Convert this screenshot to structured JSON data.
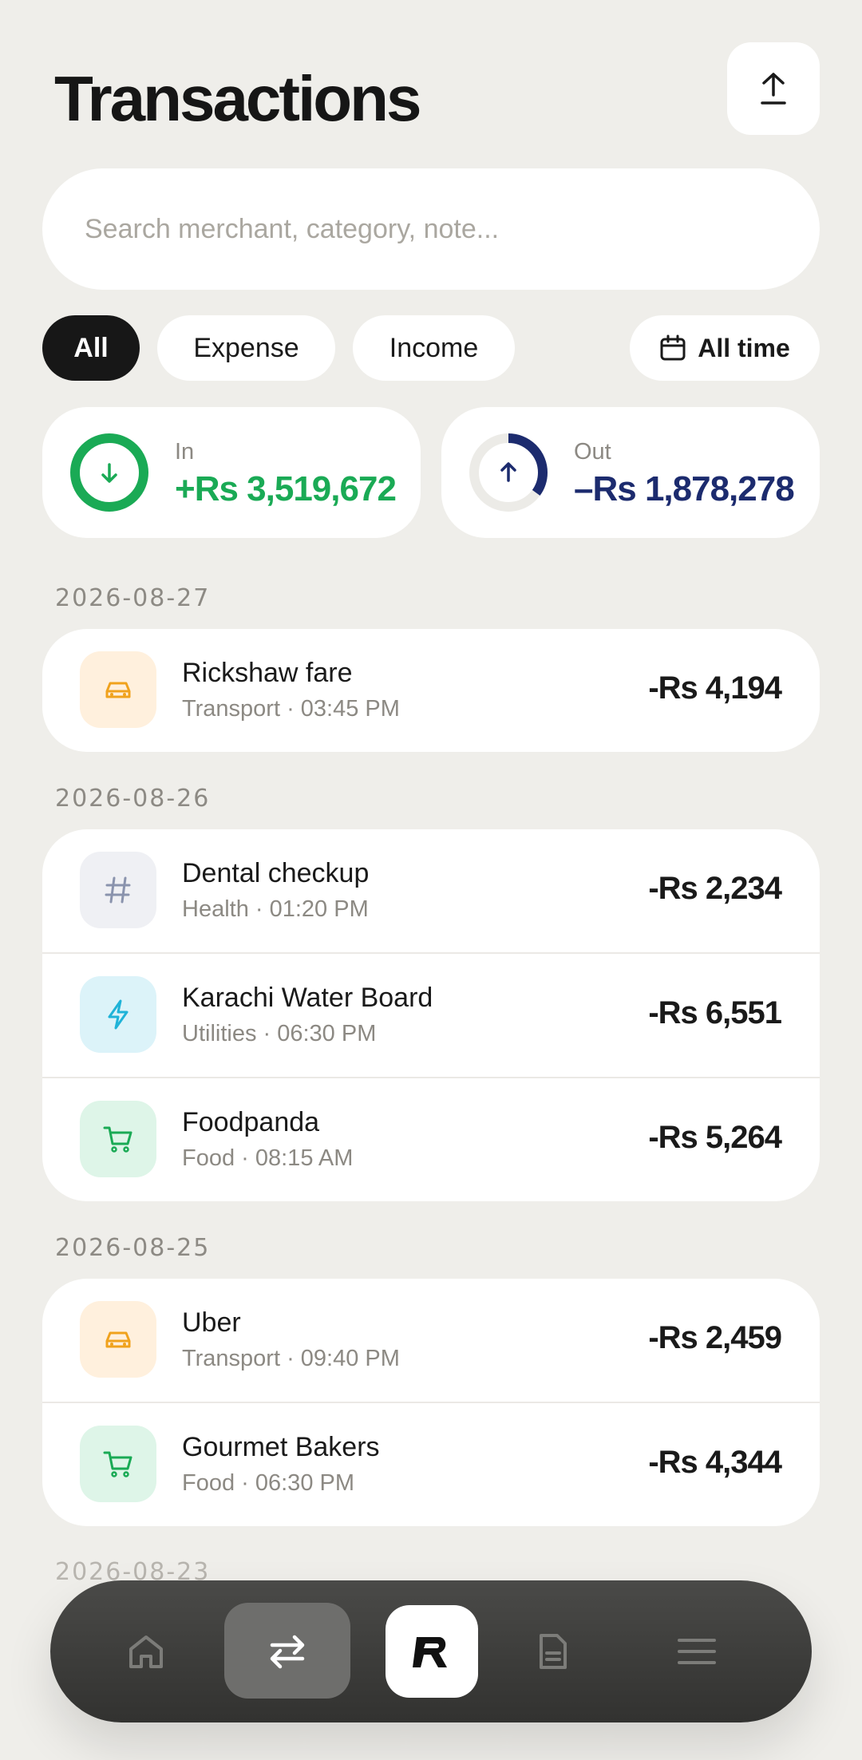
{
  "header": {
    "title": "Transactions",
    "export_icon": "upload-icon"
  },
  "search": {
    "placeholder": "Search merchant, category, note..."
  },
  "filters": {
    "chips": [
      {
        "label": "All",
        "active": true
      },
      {
        "label": "Expense",
        "active": false
      },
      {
        "label": "Income",
        "active": false
      }
    ],
    "date_range": {
      "label": "All time",
      "icon": "calendar-icon"
    }
  },
  "summary": {
    "in": {
      "label": "In",
      "value": "+Rs 3,519,672",
      "color": "#1aaa55",
      "ring_fill": 1.0
    },
    "out": {
      "label": "Out",
      "value": "–Rs 1,878,278",
      "color": "#1c2b6e",
      "ring_fill": 0.35
    }
  },
  "groups": [
    {
      "date": "2026-08-27",
      "items": [
        {
          "title": "Rickshaw fare",
          "sub": "Transport · 03:45 PM",
          "amount": "-Rs 4,194",
          "icon": "car-icon"
        }
      ]
    },
    {
      "date": "2026-08-26",
      "items": [
        {
          "title": "Dental checkup",
          "sub": "Health · 01:20 PM",
          "amount": "-Rs 2,234",
          "icon": "hash-icon"
        },
        {
          "title": "Karachi Water Board",
          "sub": "Utilities · 06:30 PM",
          "amount": "-Rs 6,551",
          "icon": "bolt-icon"
        },
        {
          "title": "Foodpanda",
          "sub": "Food · 08:15 AM",
          "amount": "-Rs 5,264",
          "icon": "cart-icon"
        }
      ]
    },
    {
      "date": "2026-08-25",
      "items": [
        {
          "title": "Uber",
          "sub": "Transport · 09:40 PM",
          "amount": "-Rs 2,459",
          "icon": "car-icon"
        },
        {
          "title": "Gourmet Bakers",
          "sub": "Food · 06:30 PM",
          "amount": "-Rs 4,344",
          "icon": "cart-icon"
        }
      ]
    }
  ],
  "peek_date": "2026-08-23",
  "nav": {
    "items": [
      "home-icon",
      "transfer-icon",
      "app-logo-icon",
      "document-icon",
      "menu-icon"
    ],
    "active": "transfer-icon"
  }
}
